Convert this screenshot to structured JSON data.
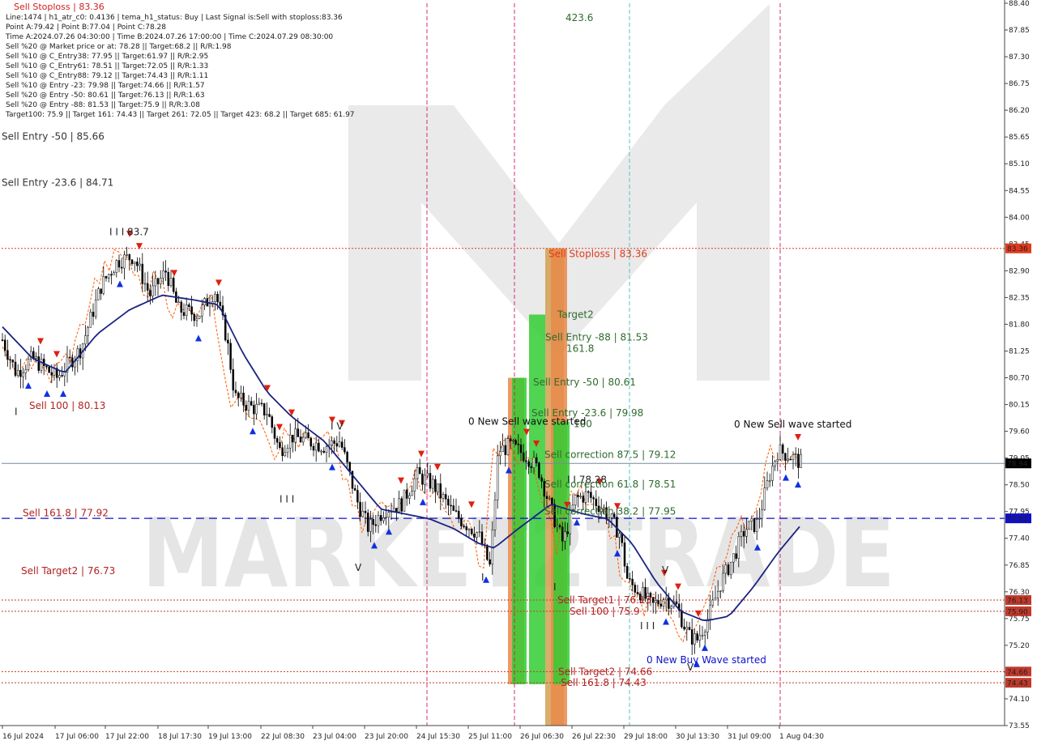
{
  "info_lines": [
    "Line:1474 | h1_atr_c0: 0.4136 | tema_h1_status: Buy | Last Signal is:Sell with stoploss:83.36",
    "Point A:79.42 | Point B:77.04 | Point C:78.28",
    "Time A:2024.07.26 04:30:00 | Time B:2024.07.26 17:00:00 | Time C:2024.07.29 08:30:00",
    "Sell %20 @ Market price or at: 78.28 || Target:68.2 || R/R:1.98",
    "Sell %10 @ C_Entry38: 77.95 || Target:61.97 || R/R:2.95",
    "Sell %10 @ C_Entry61: 78.51 || Target:72.05 || R/R:1.33",
    "Sell %10 @ C_Entry88: 79.12 || Target:74.43 || R/R:1.11",
    "Sell %10 @ Entry -23: 79.98 || Target:74.66 || R/R:1.57",
    "Sell %20 @ Entry -50: 80.61 || Target:76.13 || R/R:1.63",
    "Sell %20 @ Entry -88: 81.53 || Target:75.9 || R/R:3.08",
    "Target100: 75.9 || Target 161: 74.43 || Target 261: 72.05 || Target 423: 68.2 || Target 685: 61.97"
  ],
  "header_stop": "Sell Stoploss | 83.36",
  "colors": {
    "ma": "#1a237e",
    "envelope": "#ff5a00",
    "candle": "#000000",
    "stop": "#e03a1e",
    "target": "#a01010",
    "blue_line": "#1010c8",
    "zone_green": "#33cc33",
    "zone_orange": "#e88a4a",
    "zone_tan": "#d2a050",
    "vline": "#d0186e",
    "vline_cyan": "#40c0c0"
  },
  "chart_data": {
    "type": "candlestick",
    "symbol_timeframe": "H1",
    "ylim": [
      73.55,
      88.4
    ],
    "y_ticks": [
      "88.40",
      "87.85",
      "87.30",
      "86.75",
      "86.20",
      "85.65",
      "85.10",
      "84.55",
      "84.00",
      "83.45",
      "82.90",
      "82.35",
      "81.80",
      "81.25",
      "80.70",
      "80.15",
      "79.60",
      "79.05",
      "78.50",
      "77.95",
      "77.40",
      "76.85",
      "76.30",
      "75.75",
      "75.20",
      "74.65",
      "74.10",
      "73.55"
    ],
    "x_labels": [
      "16 Jul 2024",
      "17 Jul 06:00",
      "17 Jul 22:00",
      "18 Jul 17:30",
      "19 Jul 13:00",
      "22 Jul 08:30",
      "23 Jul 04:00",
      "23 Jul 20:00",
      "24 Jul 15:30",
      "25 Jul 11:00",
      "26 Jul 06:30",
      "26 Jul 22:30",
      "29 Jul 18:00",
      "30 Jul 13:30",
      "31 Jul 09:00",
      "1 Aug 04:30"
    ],
    "current_price": 78.94,
    "price_tags": [
      {
        "price": 83.36,
        "text": "83.36",
        "color": "#e03a1e"
      },
      {
        "price": 78.94,
        "text": "78.94",
        "color": "#000000"
      },
      {
        "price": 77.81,
        "text": "77.81",
        "color": "#1010c8"
      },
      {
        "price": 76.13,
        "text": "76.13",
        "color": "#c0392b"
      },
      {
        "price": 75.9,
        "text": "75.90",
        "color": "#c0392b"
      },
      {
        "price": 74.66,
        "text": "74.66",
        "color": "#c0392b"
      },
      {
        "price": 74.43,
        "text": "74.43",
        "color": "#c0392b"
      }
    ],
    "hlines": [
      {
        "price": 83.36,
        "style": "dotted",
        "color": "#e03a1e"
      },
      {
        "price": 78.94,
        "style": "solid",
        "color": "#7a8a9a"
      },
      {
        "price": 77.81,
        "style": "dashed",
        "color": "#1010c8"
      },
      {
        "price": 76.13,
        "style": "dotted",
        "color": "#c0392b"
      },
      {
        "price": 75.9,
        "style": "dotted",
        "color": "#c0392b"
      },
      {
        "price": 74.66,
        "style": "dotted",
        "color": "#c0392b"
      },
      {
        "price": 74.43,
        "style": "dotted",
        "color": "#c0392b"
      }
    ],
    "annotations": [
      {
        "text": "Sell Entry -50 | 85.66",
        "price": 85.66,
        "color": "#333333"
      },
      {
        "text": "Sell Entry -23.6 | 84.71",
        "price": 84.71,
        "color": "#333333"
      },
      {
        "text": "I I I 83.7",
        "price": 83.7,
        "color": "#222222"
      },
      {
        "text": "Sell 100 | 80.13",
        "price": 80.13,
        "color": "#b22222"
      },
      {
        "text": "Sell 161.8 | 77.92",
        "price": 77.92,
        "color": "#b22222"
      },
      {
        "text": "Sell Target2 | 76.73",
        "price": 76.73,
        "color": "#b22222"
      },
      {
        "text": "I",
        "price": 80.0,
        "color": "#222222"
      },
      {
        "text": "I V",
        "price": 79.7,
        "color": "#222222"
      },
      {
        "text": "I I I",
        "price": 78.2,
        "color": "#222222"
      },
      {
        "text": "V",
        "price": 76.8,
        "color": "#222222"
      },
      {
        "text": "423.6",
        "price": 88.1,
        "color": "#2e6b2e"
      },
      {
        "text": "Sell Stoploss | 83.36",
        "price": 83.25,
        "color": "#e03a1e"
      },
      {
        "text": "Target2",
        "price": 82.0,
        "color": "#2e6b2e"
      },
      {
        "text": "Sell Entry -88 | 81.53",
        "price": 81.53,
        "color": "#2e6b2e"
      },
      {
        "text": "161.8",
        "price": 81.3,
        "color": "#2e6b2e"
      },
      {
        "text": "Sell Entry -50 | 80.61",
        "price": 80.61,
        "color": "#2e6b2e"
      },
      {
        "text": "Sell Entry -23.6 | 79.98",
        "price": 79.98,
        "color": "#2e6b2e"
      },
      {
        "text": "100",
        "price": 79.75,
        "color": "#2e6b2e"
      },
      {
        "text": "0 New Sell wave started",
        "price": 79.8,
        "color": "#111111"
      },
      {
        "text": "Sell correction 87.5 | 79.12",
        "price": 79.12,
        "color": "#2e6b2e"
      },
      {
        "text": "I I 78.28",
        "price": 78.6,
        "color": "#222222"
      },
      {
        "text": "Sell correction 61.8 | 78.51",
        "price": 78.51,
        "color": "#2e6b2e"
      },
      {
        "text": "Sell correction 38.2 | 77.95",
        "price": 77.95,
        "color": "#2e6b2e"
      },
      {
        "text": "I",
        "price": 76.6,
        "color": "#222222"
      },
      {
        "text": "I",
        "price": 76.4,
        "color": "#222222"
      },
      {
        "text": "Sell Target1 | 76.13",
        "price": 76.13,
        "color": "#b22222"
      },
      {
        "text": "Sell 100 | 75.9",
        "price": 75.9,
        "color": "#b22222"
      },
      {
        "text": "Sell Target2 | 74.66",
        "price": 74.66,
        "color": "#b22222"
      },
      {
        "text": "Sell 161.8 | 74.43",
        "price": 74.43,
        "color": "#b22222"
      },
      {
        "text": "I I I",
        "price": 75.6,
        "color": "#222222"
      },
      {
        "text": "V",
        "price": 76.75,
        "color": "#222222"
      },
      {
        "text": "0 New Buy Wave started",
        "price": 74.9,
        "color": "#1010c8"
      },
      {
        "text": "V",
        "price": 74.75,
        "color": "#222222"
      },
      {
        "text": "0 New Sell wave started",
        "price": 79.74,
        "color": "#111111"
      }
    ],
    "zones": [
      {
        "price_from": 80.7,
        "price_to": 74.4,
        "color": "#e88a4a"
      },
      {
        "price_from": 80.7,
        "price_to": 74.4,
        "color": "#33cc33"
      },
      {
        "price_from": 82.0,
        "price_to": 74.4,
        "color": "#33cc33"
      },
      {
        "price_from": 83.36,
        "price_to": 73.55,
        "color": "#d2a050"
      },
      {
        "price_from": 83.36,
        "price_to": 73.55,
        "color": "#e88a4a"
      },
      {
        "price_from": 79.8,
        "price_to": 74.4,
        "color": "#33cc33"
      }
    ],
    "watermark": "MARKET2TRADE"
  }
}
